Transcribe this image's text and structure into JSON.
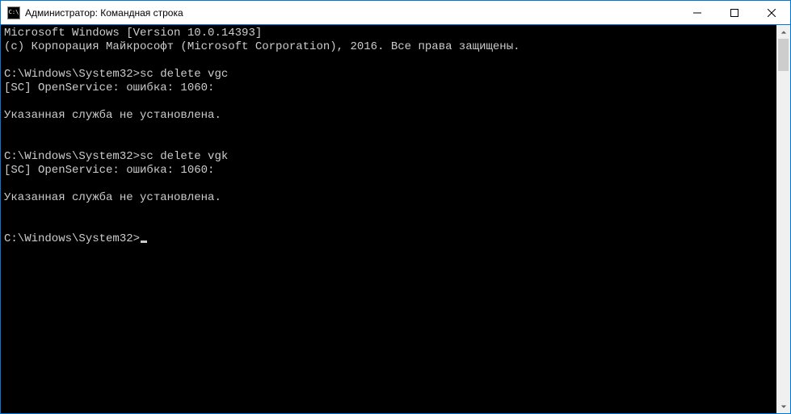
{
  "window": {
    "title": "Администратор: Командная строка",
    "icon_label": "C:\\"
  },
  "terminal": {
    "lines": [
      "Microsoft Windows [Version 10.0.14393]",
      "(c) Корпорация Майкрософт (Microsoft Corporation), 2016. Все права защищены.",
      "",
      "C:\\Windows\\System32>sc delete vgc",
      "[SC] OpenService: ошибка: 1060:",
      "",
      "Указанная служба не установлена.",
      "",
      "",
      "C:\\Windows\\System32>sc delete vgk",
      "[SC] OpenService: ошибка: 1060:",
      "",
      "Указанная служба не установлена.",
      "",
      "",
      "C:\\Windows\\System32>"
    ]
  }
}
